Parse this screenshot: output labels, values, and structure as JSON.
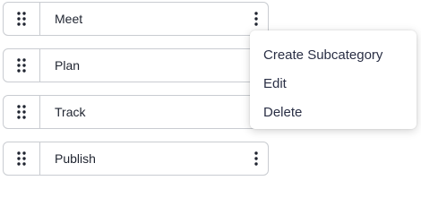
{
  "list": {
    "items": [
      {
        "label": "Meet",
        "drag_icon": "drag-handle-icon",
        "more_icon": "more-vertical-icon"
      },
      {
        "label": "Plan",
        "drag_icon": "drag-handle-icon"
      },
      {
        "label": "Track",
        "drag_icon": "drag-handle-icon"
      },
      {
        "label": "Publish",
        "drag_icon": "drag-handle-icon",
        "more_icon": "more-vertical-icon"
      }
    ]
  },
  "context_menu": {
    "items": [
      {
        "label": "Create Subcategory"
      },
      {
        "label": "Edit"
      },
      {
        "label": "Delete"
      }
    ]
  },
  "colors": {
    "border": "#c9ccd1",
    "text": "#1f2430",
    "icon": "#1f2430"
  }
}
